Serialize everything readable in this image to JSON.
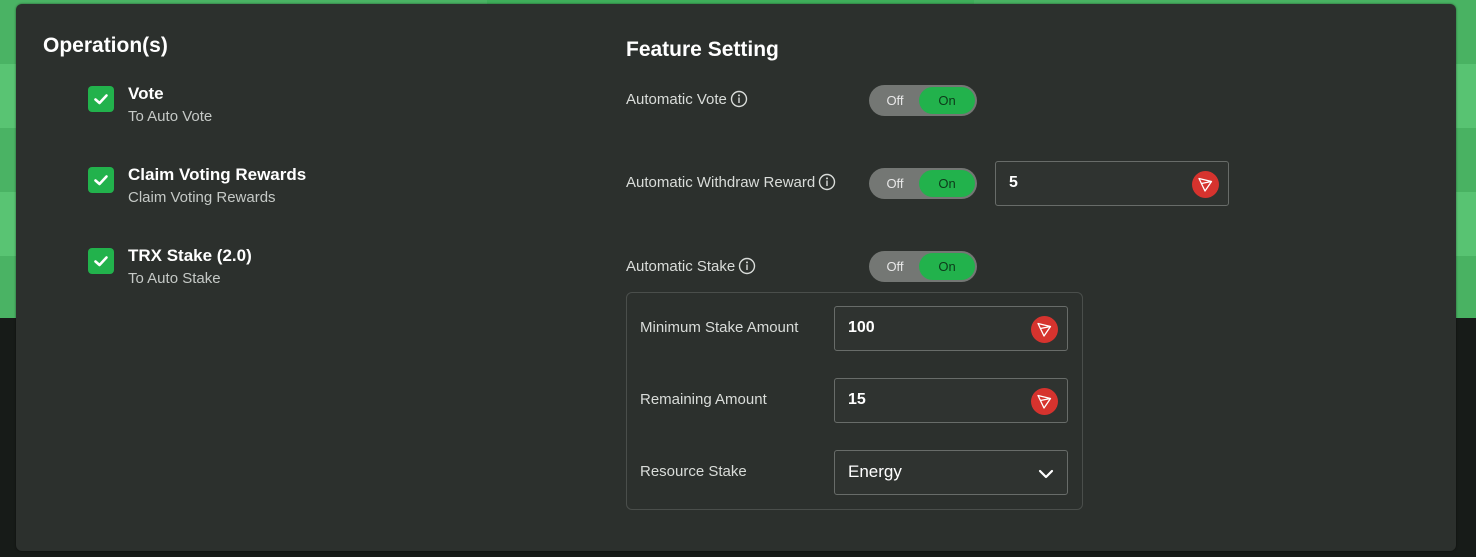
{
  "operations": {
    "title": "Operation(s)",
    "items": [
      {
        "title": "Vote",
        "subtitle": "To Auto Vote",
        "checked": true
      },
      {
        "title": "Claim Voting Rewards",
        "subtitle": "Claim Voting Rewards",
        "checked": true
      },
      {
        "title": "TRX Stake (2.0)",
        "subtitle": "To Auto Stake",
        "checked": true
      }
    ]
  },
  "features": {
    "title": "Feature Setting",
    "auto_vote": {
      "label": "Automatic Vote",
      "off": "Off",
      "on": "On",
      "state": "on"
    },
    "auto_withdraw": {
      "label": "Automatic Withdraw Reward",
      "off": "Off",
      "on": "On",
      "state": "on",
      "value": "5",
      "currency_icon": "trx-icon"
    },
    "auto_stake": {
      "label": "Automatic Stake",
      "off": "Off",
      "on": "On",
      "state": "on"
    },
    "stake_settings": {
      "min_label": "Minimum Stake Amount",
      "min_value": "100",
      "remaining_label": "Remaining Amount",
      "remaining_value": "15",
      "resource_label": "Resource Stake",
      "resource_value": "Energy"
    }
  },
  "colors": {
    "accent_green": "#22b24c",
    "panel": "#2c302d",
    "trx_red": "#d6332e"
  }
}
